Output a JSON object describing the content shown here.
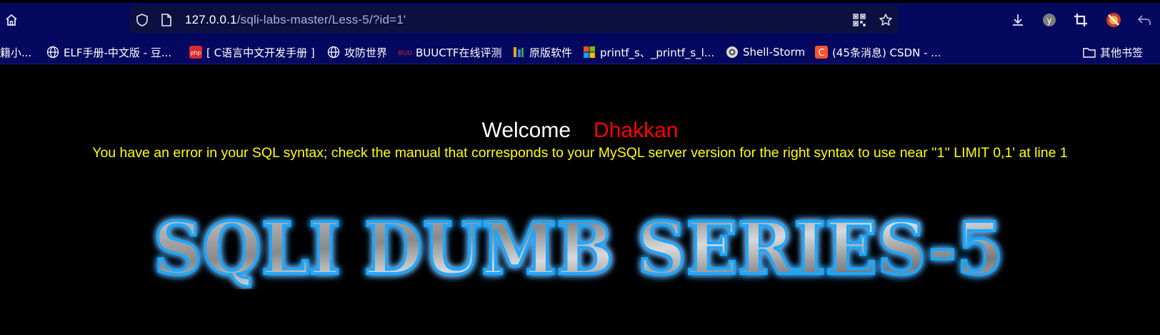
{
  "browser": {
    "url_host": "127.0.0.1",
    "url_path": "/sqli-labs-master/Less-5/?id=1'"
  },
  "bookmarks": [
    {
      "label": "籍小...",
      "icon": "partial-icon"
    },
    {
      "label": "ELF手册-中文版 - 豆...",
      "icon": "globe-icon"
    },
    {
      "label": "[ C语言中文开发手册 ]",
      "icon": "php-icon"
    },
    {
      "label": "攻防世界",
      "icon": "globe-icon"
    },
    {
      "label": "BUUCTF在线评测",
      "icon": "buu-icon"
    },
    {
      "label": "原版软件",
      "icon": "itellyou-icon"
    },
    {
      "label": "printf_s、_printf_s_l...",
      "icon": "microsoft-icon"
    },
    {
      "label": "Shell-Storm",
      "icon": "shellstorm-icon"
    },
    {
      "label": "(45条消息) CSDN - ...",
      "icon": "csdn-icon"
    }
  ],
  "other_bookmarks": "其他书签",
  "page": {
    "welcome": "Welcome",
    "name": "Dhakkan",
    "error": "You have an error in your SQL syntax; check the manual that corresponds to your MySQL server version for the right syntax to use near ''1'' LIMIT 0,1' at line 1",
    "logo_text": "SQLI DUMB SERIES-5"
  },
  "colors": {
    "toolbar": "#04085f",
    "error": "#ffff00",
    "name": "#ff0000",
    "logo_glow": "#1ea7ff"
  }
}
